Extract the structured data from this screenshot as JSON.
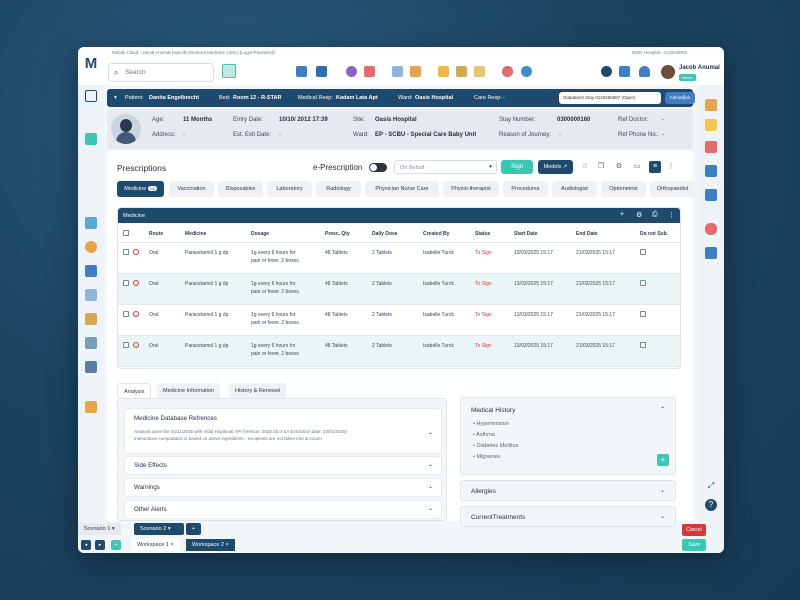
{
  "window": {
    "title_left": "Mobile Cloud - Jacob Anumal (specific)General Medicine Clinic) [Login/Password]",
    "title_right": "DMO Hospital - CASHIERS"
  },
  "search": {
    "placeholder": "Search"
  },
  "user": {
    "name": "Jacob Anumal",
    "role": "Nurse"
  },
  "patient_bar": {
    "patient_label": "Patient:",
    "patient": "Danita Engelbrecht",
    "bed_label": "Bed:",
    "bed": "Room 12 - R-STAR",
    "medical_resp_label": "Medical Resp:",
    "medical_resp": "Kadam Lata Apt",
    "ward_label": "Ward:",
    "ward": "Oasis Hospital",
    "care_resp_label": "Care Resp:",
    "care_resp": "-",
    "stay_select": "Outpatient Stay 0123456987 (Open)",
    "admission": "Admission"
  },
  "info": {
    "age_label": "Age:",
    "age": "11 Months",
    "address_label": "Address:",
    "address": "-",
    "entry_date_label": "Entry Date:",
    "entry_date": "10/10/ 2012  17:39",
    "exit_date_label": "Est. Exit Date:",
    "exit_date": "-",
    "site_label": "Site:",
    "site": "Oasis Hospital",
    "ward_label": "Ward:",
    "ward": "EP - SCBU - Special Care Baby Unit",
    "stay_number_label": "Stay Number:",
    "stay_number": "0300000160",
    "reason_label": "Reason of Journey:",
    "reason": "-",
    "ref_doctor_label": "Ref Doctor:",
    "ref_doctor": "-",
    "ref_phone_label": "Ref Phone No.:",
    "ref_phone": "-"
  },
  "prescriptions": {
    "title": "Prescriptions",
    "eprescription": "e-Prescription",
    "on_behalf": "On Behalf",
    "sign": "Sign",
    "models": "Models"
  },
  "tabs": [
    {
      "label": "Medicine",
      "badge": "04"
    },
    {
      "label": "Vaccination"
    },
    {
      "label": "Disposables"
    },
    {
      "label": "Laboratory"
    },
    {
      "label": "Radiology"
    },
    {
      "label": "Physician Nurse Care"
    },
    {
      "label": "Physio-therapist"
    },
    {
      "label": "Procedures"
    },
    {
      "label": "Audiologist"
    },
    {
      "label": "Optometrist"
    },
    {
      "label": "Orthopaedist"
    }
  ],
  "medicine_table": {
    "title": "Medicine",
    "columns": [
      "Route",
      "Medicine",
      "Dosage",
      "Presc. Qty",
      "Daily Dose",
      "Created By",
      "Status",
      "Start Date",
      "End Date",
      "Do not Sub."
    ],
    "rows": [
      {
        "route": "Oral",
        "medicine": "Paracetamol 1 g dp",
        "dosage1": "1g every 6 hours for",
        "dosage2": "pain or fever. 2 boxes.",
        "qty": "48 Tablets",
        "daily": "2 Tablets",
        "created": "Isabelle Turck",
        "status": "To Sign",
        "start": "13/03/2025 15:17",
        "end": "21/03/2025 15:17"
      },
      {
        "route": "Oral",
        "medicine": "Paracetamol 1 g dp",
        "dosage1": "1g every 6 hours for",
        "dosage2": "pain or fever. 2 boxes.",
        "qty": "48 Tablets",
        "daily": "2 Tablets",
        "created": "Isabelle Turck",
        "status": "To Sign",
        "start": "13/03/2025 15:17",
        "end": "21/03/2025 15:17"
      },
      {
        "route": "Oral",
        "medicine": "Paracetamol 1 g dp",
        "dosage1": "1g every 6 hours for",
        "dosage2": "pain or fever. 2 boxes.",
        "qty": "48 Tablets",
        "daily": "2 Tablets",
        "created": "Isabelle Turck",
        "status": "To Sign",
        "start": "13/03/2025 15:17",
        "end": "21/03/2025 15:17"
      },
      {
        "route": "Oral",
        "medicine": "Paracetamol 1 g dp",
        "dosage1": "1g every 6 hours for",
        "dosage2": "pain or fever. 2 boxes.",
        "qty": "48 Tablets",
        "daily": "2 Tablets",
        "created": "Isabelle Turck",
        "status": "To Sign",
        "start": "13/03/2025 15:17",
        "end": "21/03/2025 15:17"
      }
    ]
  },
  "subtabs": [
    "Analysis",
    "Medicine Information",
    "History & Renewel"
  ],
  "analysis": {
    "db_title": "Medicine Database Refrences",
    "db_desc1": "Analysis done the 04/11/2025 with Vidal Hopitimal API (Version: 2025.03.0-SA Extraction date: 23/01/2025)",
    "db_desc2": "Interactions computation is based on active ingredients - excipients are not taken into account!",
    "side_effects": "Side Effects",
    "warnings": "Warnings",
    "other_alerts": "Other Alerts"
  },
  "medical_history": {
    "title": "Medical History",
    "items": [
      "Hypertension",
      "Asthma",
      "Diabetes Mellitus",
      "Migraines"
    ]
  },
  "allergies": {
    "title": "Allergies"
  },
  "current_treatments": {
    "title": "CurrentTreatments"
  },
  "bottom": {
    "scenario1": "Scenario 1",
    "scenario2": "Scenario 2",
    "workspace1": "Workspace 1",
    "workspace2": "Workspace 2",
    "cancel": "Cancel",
    "save": "Save"
  },
  "colors": {
    "primary": "#1e4a6d",
    "accent": "#3cc6b4",
    "danger": "#d23b3b"
  }
}
